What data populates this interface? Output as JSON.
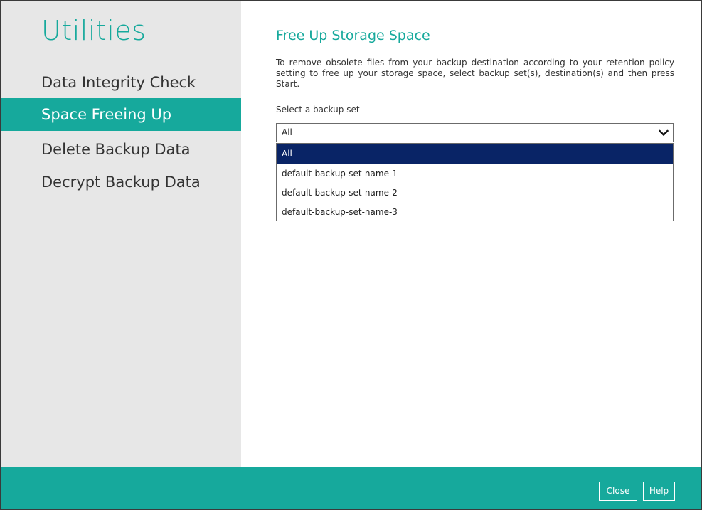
{
  "sidebar": {
    "title": "Utilities",
    "items": [
      {
        "label": "Data Integrity Check",
        "active": false
      },
      {
        "label": "Space Freeing Up",
        "active": true
      },
      {
        "label": "Delete Backup Data",
        "active": false
      },
      {
        "label": "Decrypt Backup Data",
        "active": false
      }
    ]
  },
  "main": {
    "title": "Free Up Storage Space",
    "description": "To remove obsolete files from your backup destination according to your retention policy setting to free up your storage space, select backup set(s), destination(s) and then press Start.",
    "select_label": "Select a backup set",
    "select_value": "All",
    "options": [
      {
        "label": "All",
        "selected": true
      },
      {
        "label": "default-backup-set-name-1",
        "selected": false
      },
      {
        "label": "default-backup-set-name-2",
        "selected": false
      },
      {
        "label": "default-backup-set-name-3",
        "selected": false
      }
    ]
  },
  "footer": {
    "close_label": "Close",
    "help_label": "Help"
  },
  "colors": {
    "accent": "#16a99c",
    "sidebar_bg": "#e7e7e7",
    "selected_option_bg": "#092466"
  },
  "icons": {
    "select_toggle": "chevron-down-icon"
  }
}
